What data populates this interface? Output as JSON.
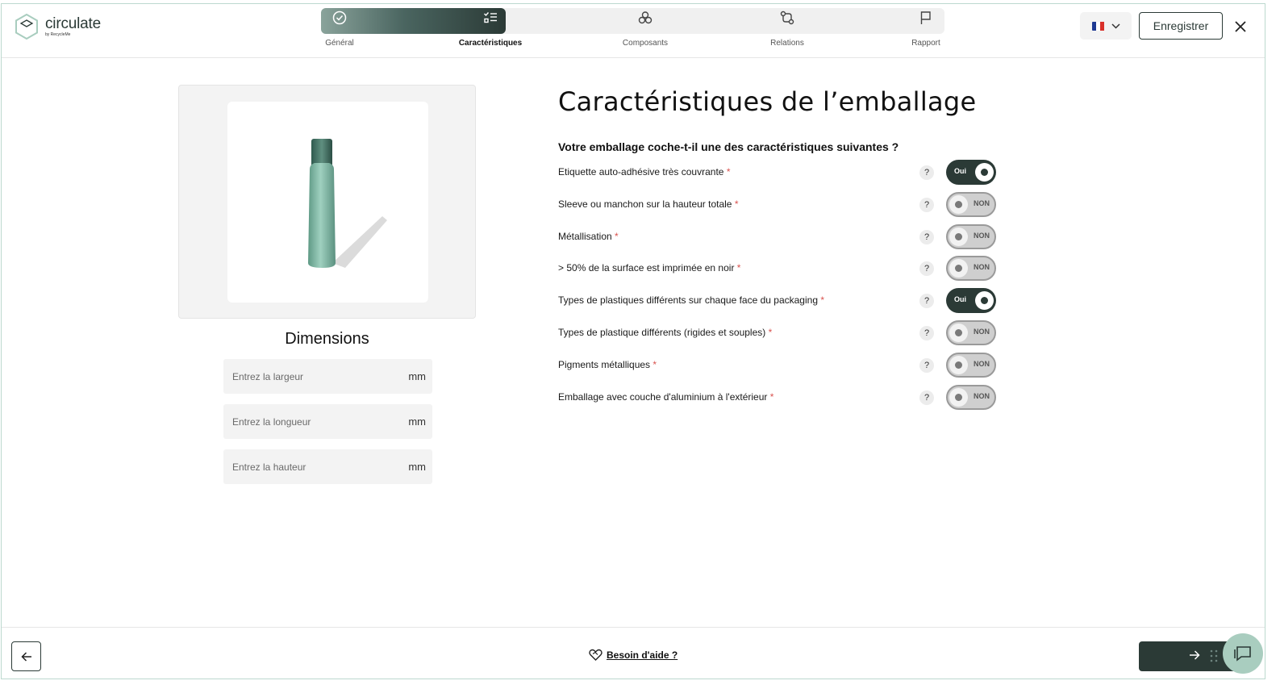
{
  "app": {
    "logo_name": "circulate",
    "logo_sub": "by RecycleMe"
  },
  "steps": [
    {
      "label": "Général",
      "icon": "check-circle-icon",
      "state": "done"
    },
    {
      "label": "Caractéristiques",
      "icon": "list-check-icon",
      "state": "active"
    },
    {
      "label": "Composants",
      "icon": "components-icon",
      "state": "todo"
    },
    {
      "label": "Relations",
      "icon": "relations-icon",
      "state": "todo"
    },
    {
      "label": "Rapport",
      "icon": "flag-icon",
      "state": "todo"
    }
  ],
  "header": {
    "language": "FR",
    "save_label": "Enregistrer"
  },
  "dimensions": {
    "title": "Dimensions",
    "fields": [
      {
        "placeholder": "Entrez la largeur",
        "value": "",
        "unit": "mm"
      },
      {
        "placeholder": "Entrez la longueur",
        "value": "",
        "unit": "mm"
      },
      {
        "placeholder": "Entrez la hauteur",
        "value": "",
        "unit": "mm"
      }
    ]
  },
  "main": {
    "title": "Caractéristiques de l’emballage",
    "question": "Votre emballage coche-t-il une des caractéristiques suivantes ?",
    "items": [
      {
        "label": "Etiquette auto-adhésive très couvrante",
        "required": "*",
        "help": "?",
        "state": "on",
        "toggle_text": "Oui"
      },
      {
        "label": "Sleeve ou manchon sur la hauteur totale",
        "required": "*",
        "help": "?",
        "state": "off",
        "toggle_text": "NON"
      },
      {
        "label": "Métallisation",
        "required": "*",
        "help": "?",
        "state": "off",
        "toggle_text": "NON"
      },
      {
        "label": "> 50% de la surface est imprimée en noir",
        "required": "*",
        "help": "?",
        "state": "off",
        "toggle_text": "NON"
      },
      {
        "label": "Types de plastiques différents sur chaque face du packaging",
        "required": "*",
        "help": "?",
        "state": "on",
        "toggle_text": "Oui"
      },
      {
        "label": "Types de plastique différents (rigides et souples)",
        "required": "*",
        "help": "?",
        "state": "off",
        "toggle_text": "NON"
      },
      {
        "label": "Pigments métalliques",
        "required": "*",
        "help": "?",
        "state": "off",
        "toggle_text": "NON"
      },
      {
        "label": "Emballage avec couche d'aluminium à l'extérieur",
        "required": "*",
        "help": "?",
        "state": "off",
        "toggle_text": "NON"
      }
    ]
  },
  "footer": {
    "help_label": "Besoin d'aide ?"
  },
  "colors": {
    "brand_dark": "#2b3a36",
    "brand_light": "#a9cdbf",
    "required": "#d9534f"
  }
}
